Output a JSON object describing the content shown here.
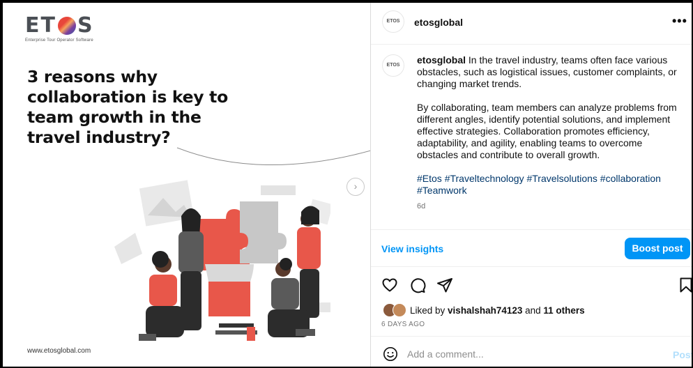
{
  "image": {
    "logo": {
      "text_left": "ET",
      "text_right": "S",
      "subtitle": "Enterprise Tour Operator Software"
    },
    "headline": "3 reasons why\ncollaboration is key to\nteam growth in the\ntravel industry?",
    "website": "www.etosglobal.com"
  },
  "header": {
    "avatar_text": "ETOS",
    "username": "etosglobal",
    "more_icon": "more-horizontal-icon"
  },
  "caption": {
    "avatar_text": "ETOS",
    "username": "etosglobal",
    "para1": " In the travel industry, teams often face various obstacles, such as logistical issues, customer complaints, or changing market trends.",
    "para2": "By collaborating, team members can analyze problems from different angles, identify potential solutions, and implement effective strategies. Collaboration promotes efficiency, adaptability, and agility, enabling teams to overcome obstacles and contribute to overall growth.",
    "hashtags": [
      "#Etos",
      "#Traveltechnology",
      "#Travelsolutions",
      "#collaboration",
      "#Teamwork"
    ],
    "time_ago": "6d"
  },
  "actions": {
    "view_insights": "View insights",
    "boost_post": "Boost post",
    "icons": [
      "heart-icon",
      "comment-icon",
      "share-icon",
      "bookmark-icon"
    ]
  },
  "likes": {
    "prefix": "Liked by ",
    "user": "vishalshah74123",
    "middle": " and ",
    "others": "11 others"
  },
  "date": "6 DAYS AGO",
  "comment": {
    "placeholder": "Add a comment...",
    "post_label": "Post"
  },
  "colors": {
    "accent": "#0095f6",
    "brand_red": "#e8463b",
    "hashtag": "#00376b"
  }
}
